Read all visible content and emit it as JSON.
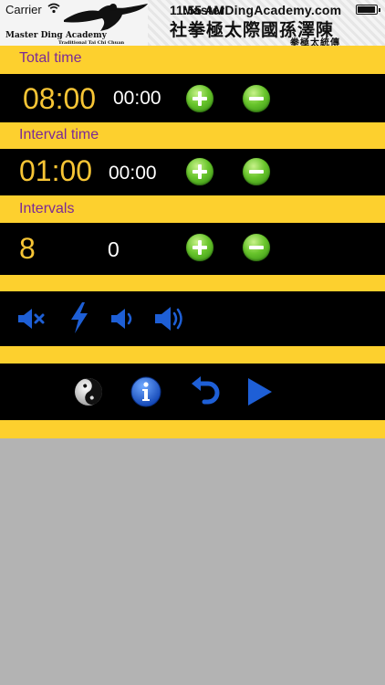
{
  "status_bar": {
    "carrier": "Carrier",
    "time": "11:55 AM",
    "site": "MasterDingAcademy.com"
  },
  "logo": {
    "name": "Master Ding Academy",
    "subtitle": "Traditional Tai Chi Chuan",
    "chinese_main": "社拳極太際國孫澤陳",
    "chinese_sub": "拳極太統傳"
  },
  "total_time": {
    "label": "Total time",
    "value": "08:00",
    "elapsed": "00:00"
  },
  "interval_time": {
    "label": "Interval time",
    "value": "01:00",
    "elapsed": "00:00"
  },
  "intervals": {
    "label": "Intervals",
    "value": "8",
    "count": "0"
  },
  "sound_controls": [
    "mute-icon",
    "lightning-icon",
    "volume-low-icon",
    "volume-high-icon"
  ],
  "playback_controls": [
    "yin-yang-icon",
    "info-icon",
    "reset-icon",
    "play-icon"
  ],
  "colors": {
    "yellow": "#fdd02e",
    "label_purple": "#7b2a96",
    "value_yellow": "#f7c535",
    "icon_blue": "#1e5fd6",
    "button_green": "#4fb41f",
    "background_gray": "#b3b3b3"
  }
}
